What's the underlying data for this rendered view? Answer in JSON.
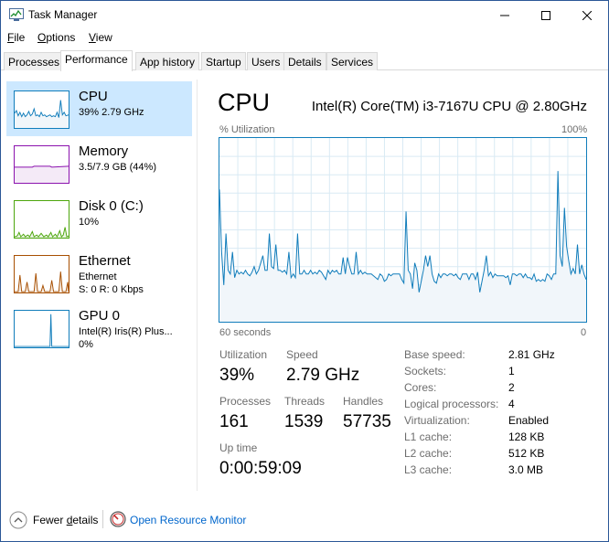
{
  "window": {
    "title": "Task Manager",
    "controls": {
      "minimize": "—",
      "maximize": "☐",
      "close": "✕"
    }
  },
  "menu": {
    "file": {
      "u": "F",
      "rest": "ile"
    },
    "options": {
      "u": "O",
      "rest": "ptions"
    },
    "view": {
      "u": "V",
      "rest": "iew"
    }
  },
  "tabs": [
    "Processes",
    "Performance",
    "App history",
    "Startup",
    "Users",
    "Details",
    "Services"
  ],
  "active_tab": "Performance",
  "sidebar": {
    "items": [
      {
        "title": "CPU",
        "sub1": "39% 2.79 GHz",
        "sub2": "",
        "color": "#117dbb",
        "selected": true
      },
      {
        "title": "Memory",
        "sub1": "3.5/7.9 GB (44%)",
        "sub2": "",
        "color": "#8b12ae"
      },
      {
        "title": "Disk 0 (C:)",
        "sub1": "10%",
        "sub2": "",
        "color": "#4da60c"
      },
      {
        "title": "Ethernet",
        "sub1": "Ethernet",
        "sub2": "S: 0 R: 0 Kbps",
        "color": "#a74f01"
      },
      {
        "title": "GPU 0",
        "sub1": "Intel(R) Iris(R) Plus...",
        "sub2": "0%",
        "color": "#117dbb"
      }
    ]
  },
  "cpu": {
    "title": "CPU",
    "model": "Intel(R) Core(TM) i3-7167U CPU @ 2.80GHz",
    "graph": {
      "y_label": "% Utilization",
      "y_max_label": "100%",
      "x_left_label": "60 seconds",
      "x_right_label": "0",
      "line_color": "#117dbb",
      "fill_color": "#f1f6fa",
      "grid_color": "#d9eaf4",
      "utilization_series": [
        72,
        38,
        20,
        48,
        28,
        26,
        38,
        24,
        28,
        26,
        27,
        26,
        28,
        26,
        25,
        27,
        30,
        26,
        28,
        32,
        36,
        28,
        28,
        48,
        30,
        29,
        42,
        28,
        28,
        27,
        28,
        26,
        38,
        24,
        26,
        24,
        48,
        26,
        26,
        28,
        26,
        26,
        28,
        26,
        27,
        26,
        28,
        27,
        25,
        23,
        28,
        26,
        28,
        27,
        28,
        26,
        26,
        35,
        26,
        35,
        30,
        26,
        26,
        38,
        26,
        28,
        26,
        27,
        26,
        26,
        26,
        25,
        24,
        23,
        26,
        25,
        22,
        23,
        26,
        25,
        26,
        26,
        26,
        26,
        23,
        21,
        60,
        28,
        26,
        18,
        32,
        28,
        16,
        22,
        28,
        36,
        30,
        36,
        26,
        22,
        21,
        26,
        24,
        26,
        26,
        25,
        26,
        26,
        25,
        26,
        24,
        23,
        26,
        26,
        26,
        23,
        26,
        26,
        23,
        27,
        16,
        22,
        28,
        36,
        25,
        27,
        24,
        26,
        25,
        25,
        25,
        25,
        24,
        25,
        20,
        26,
        26,
        25,
        26,
        26,
        24,
        26,
        24,
        24,
        23,
        26,
        22,
        23,
        22,
        23,
        22,
        26,
        25,
        23,
        26,
        26,
        82,
        36,
        30,
        62,
        41,
        33,
        26,
        29,
        26,
        42,
        26,
        31,
        26,
        23
      ]
    },
    "stats": {
      "utilization": {
        "label": "Utilization",
        "value": "39%"
      },
      "speed": {
        "label": "Speed",
        "value": "2.79 GHz"
      },
      "processes": {
        "label": "Processes",
        "value": "161"
      },
      "threads": {
        "label": "Threads",
        "value": "1539"
      },
      "handles": {
        "label": "Handles",
        "value": "57735"
      },
      "uptime": {
        "label": "Up time",
        "value": "0:00:59:09"
      }
    },
    "info": [
      {
        "label": "Base speed:",
        "value": "2.81 GHz"
      },
      {
        "label": "Sockets:",
        "value": "1"
      },
      {
        "label": "Cores:",
        "value": "2"
      },
      {
        "label": "Logical processors:",
        "value": "4"
      },
      {
        "label": "Virtualization:",
        "value": "Enabled"
      },
      {
        "label": "L1 cache:",
        "value": "128 KB"
      },
      {
        "label": "L2 cache:",
        "value": "512 KB"
      },
      {
        "label": "L3 cache:",
        "value": "3.0 MB"
      }
    ]
  },
  "footer": {
    "fewer_u": "d",
    "fewer_pre": "Fewer ",
    "fewer_post": "etails",
    "open_resource_monitor": "Open Resource Monitor"
  },
  "icons": {
    "app": "task-manager-icon",
    "fewer": "chevron-up-icon",
    "monitor": "resource-monitor-icon"
  }
}
